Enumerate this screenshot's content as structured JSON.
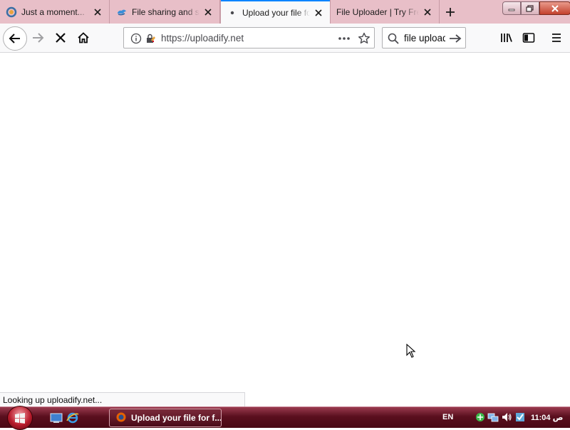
{
  "tabs": [
    {
      "title": "Just a moment...",
      "favicon": "firefox-loading-icon",
      "active": false
    },
    {
      "title": "File sharing and storage",
      "favicon": "cloud-icon",
      "active": false
    },
    {
      "title": "Upload your file for free",
      "favicon": "loading-dot-icon",
      "active": true
    },
    {
      "title": "File Uploader | Try Free",
      "favicon": "none",
      "active": false
    }
  ],
  "navbar": {
    "url": "https://uploadify.net",
    "search_value": "file uploader"
  },
  "status": {
    "text": "Looking up uploadify.net..."
  },
  "taskbar": {
    "window_button": "Upload your file for f...",
    "language": "EN",
    "clock": "11:04 ص"
  },
  "colors": {
    "tabstrip": "#e8bfc8",
    "active_tab_accent": "#0a84ff",
    "taskbar": "#5a0f1e"
  }
}
